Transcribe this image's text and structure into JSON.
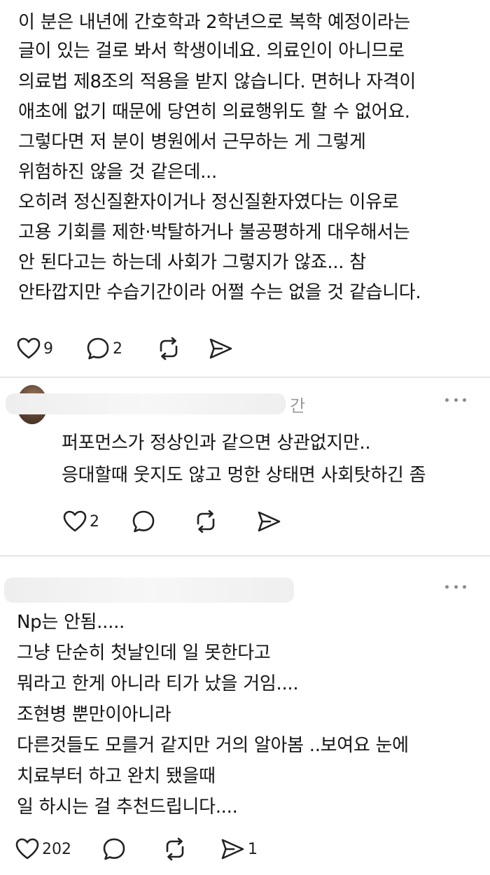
{
  "post1": {
    "lines": [
      "이 분은 내년에 간호학과 2학년으로 복학 예정이라는",
      "글이 있는 걸로 봐서 학생이네요. 의료인이 아니므로",
      "의료법 제8조의 적용을 받지 않습니다. 면허나 자격이",
      "애초에 없기 때문에 당연히 의료행위도 할 수 없어요.",
      "그렇다면 저 분이 병원에서 근무하는 게 그렇게",
      "위험하진 않을 것 같은데...",
      "오히려 정신질환자이거나 정신질환자였다는 이유로",
      "고용 기회를 제한·박탈하거나 불공평하게 대우해서는",
      "안 된다고는 하는데 사회가 그렇지가 않죠... 참",
      "안타깝지만 수습기간이라 어쩔 수는 없을 것 같습니다."
    ],
    "like_count": "9",
    "comment_count": "2",
    "repost_count": "",
    "share_count": ""
  },
  "reply1": {
    "username_visible": "간",
    "lines": [
      "퍼포먼스가 정상인과 같으면 상관없지만..",
      "응대할때 웃지도 않고 멍한 상태면 사회탓하긴 좀"
    ],
    "like_count": "2",
    "comment_count": "",
    "repost_count": "",
    "share_count": ""
  },
  "post2": {
    "lines": [
      "Np는 안됨.....",
      "그냥 단순히 첫날인데 일 못한다고",
      "뭐라고 한게 아니라 티가 났을 거임....",
      "조현병 뿐만이아니라",
      " 다른것들도 모를거 같지만 거의 알아봄 ..보여요 눈에",
      "치료부터 하고  완치 됐을때",
      " 일 하시는 걸 추천드립니다...."
    ],
    "like_count": "202",
    "comment_count": "",
    "repost_count": "",
    "share_count": "1"
  },
  "icons": {
    "like": "heart-icon",
    "comment": "speech-bubble-icon",
    "repost": "repost-icon",
    "share": "send-icon",
    "more": "more-dots-icon"
  },
  "colors": {
    "text": "#151515",
    "icon": "#222222",
    "muted": "#9a9a9a",
    "divider": "#e6e6e6"
  }
}
